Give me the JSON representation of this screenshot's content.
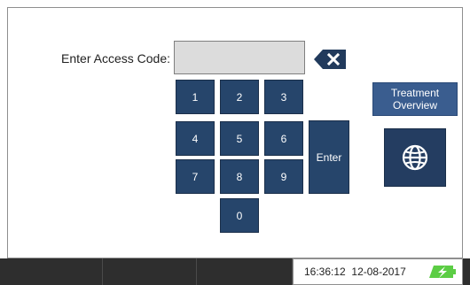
{
  "access": {
    "label": "Enter Access Code:",
    "code_value": ""
  },
  "keypad": {
    "keys": [
      "1",
      "2",
      "3",
      "4",
      "5",
      "6",
      "7",
      "8",
      "9",
      "0"
    ],
    "enter_label": "Enter"
  },
  "side": {
    "treatment_line1": "Treatment",
    "treatment_line2": "Overview",
    "globe_icon": "globe-icon",
    "backspace_icon": "backspace-icon"
  },
  "status": {
    "time": "16:36:12",
    "date": "12-08-2017",
    "battery_icon": "battery-charging-icon"
  },
  "colors": {
    "key_bg": "#26456b",
    "status_bg": "#2e2e2e",
    "battery_green": "#4cc23a"
  }
}
